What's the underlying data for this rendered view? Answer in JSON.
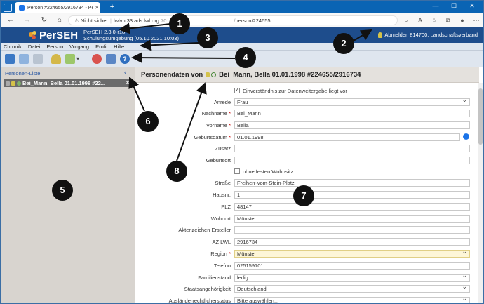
{
  "browser": {
    "tab_title": "Person #224655/2916734 - PerS",
    "address": {
      "security": "Nicht sicher",
      "host": "lwlvnt33.ads.lwl.org",
      "port": ":70",
      "path": "person/224655"
    }
  },
  "app": {
    "logo": "PerSEH",
    "version": "PerSEH 2.3.0-r18",
    "environment": "Schulungsumgebung (05.10.2021 10:03)",
    "user": "Abmelden 814700, Landschaftsverband"
  },
  "menu": [
    "Chronik",
    "Datei",
    "Person",
    "Vorgang",
    "Profil",
    "Hilfe"
  ],
  "left_panel": {
    "title": "Personen-Liste",
    "items": [
      {
        "label": "Bei_Mann, Bella 01.01.1998 #22..."
      }
    ]
  },
  "main": {
    "header_prefix": "Personendaten von",
    "header_name": "Bei_Mann, Bella 01.01.1998 #224655/2916734",
    "consent": "Einverständnis zur Datenweitergabe liegt vor",
    "no_address": "ohne festen Wohnsitz",
    "fields": {
      "anrede": {
        "label": "Anrede",
        "value": "Frau"
      },
      "nachname": {
        "label": "Nachname",
        "value": "Bei_Mann"
      },
      "vorname": {
        "label": "Vorname",
        "value": "Bella"
      },
      "geburtsdatum": {
        "label": "Geburtsdatum",
        "value": "01.01.1998"
      },
      "zusatz": {
        "label": "Zusatz",
        "value": ""
      },
      "geburtsort": {
        "label": "Geburtsort",
        "value": ""
      },
      "strasse": {
        "label": "Straße",
        "value": "Freiherr-vom-Stein-Platz"
      },
      "hausnr": {
        "label": "Hausnr.",
        "value": "1"
      },
      "plz": {
        "label": "PLZ",
        "value": "48147"
      },
      "wohnort": {
        "label": "Wohnort",
        "value": "Münster"
      },
      "aktenzeichen": {
        "label": "Aktenzeichen Ersteller",
        "value": ""
      },
      "az_lwl": {
        "label": "AZ LWL",
        "value": "2916734"
      },
      "region": {
        "label": "Region",
        "value": "Münster"
      },
      "telefon": {
        "label": "Telefon",
        "value": "025159101"
      },
      "familienstand": {
        "label": "Familienstand",
        "value": "ledig"
      },
      "staatsangehoerigkeit": {
        "label": "Staatsangehörigkeit",
        "value": "Deutschland"
      },
      "auslaenderrecht": {
        "label": "Ausländerrechtlicherstatus",
        "value": "Bitte auswählen..."
      }
    },
    "required_marker": "*"
  },
  "callouts": [
    "1",
    "2",
    "3",
    "4",
    "5",
    "6",
    "7",
    "8"
  ],
  "colors": {
    "browser_blue": "#0a64b4",
    "app_header": "#1e4d8c",
    "menubar": "#dfe6ef",
    "left_panel": "#d8d4cf",
    "callout": "#111111"
  }
}
